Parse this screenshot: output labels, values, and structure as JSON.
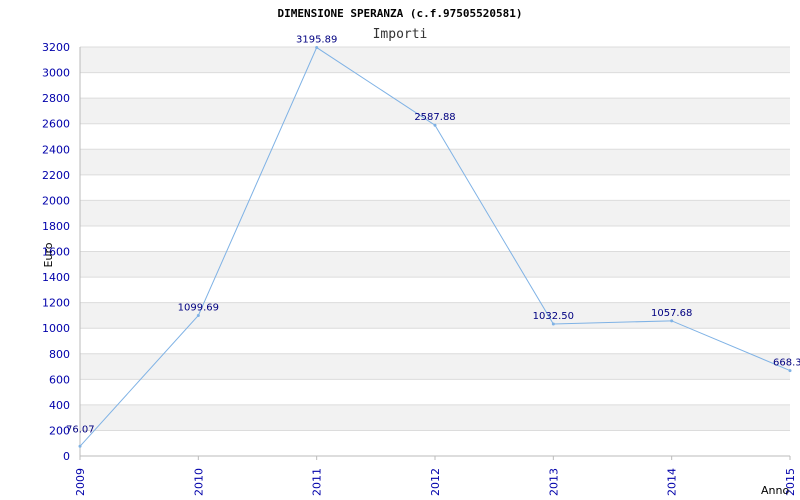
{
  "chart_data": {
    "type": "line",
    "title": "DIMENSIONE SPERANZA (c.f.97505520581)",
    "subtitle": "Importi",
    "xlabel": "Anno",
    "ylabel": "Euro",
    "categories": [
      "2009",
      "2010",
      "2011",
      "2012",
      "2013",
      "2014",
      "2015"
    ],
    "series": [
      {
        "values": [
          76.07,
          1099.69,
          3195.89,
          2587.88,
          1032.5,
          1057.68,
          668.3
        ],
        "labels": [
          "76.07",
          "1099.69",
          "3195.89",
          "2587.88",
          "1032.50",
          "1057.68",
          "668.3"
        ]
      }
    ],
    "ylim": [
      0,
      3200
    ],
    "ytick_step": 200,
    "grid": true,
    "line_color": "#7fb2e5",
    "band_color": "#f2f2f2"
  }
}
